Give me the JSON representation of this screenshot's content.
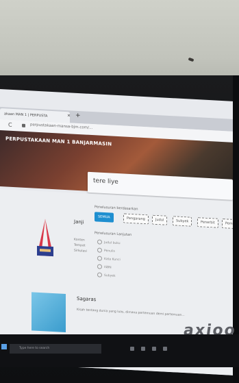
{
  "browser": {
    "tab_title": "akaan MAN 1 | PERPUSTA",
    "tab_close": "×",
    "new_tab": "+",
    "reload": "C",
    "url": "perpustakaan-mansa-bjm.com/..."
  },
  "site": {
    "banner_title": "PERPUSTAKAAN MAN 1 BANJARMASIN"
  },
  "search": {
    "query": "tere liye"
  },
  "filters": {
    "label": "Penelusuran berdasarkan",
    "buttons": [
      "SEMUA",
      "Pengarang",
      "Judul",
      "Subyek",
      "Penerbit",
      "Pem"
    ]
  },
  "fields": {
    "label": "Penelusuran Lanjutan",
    "options": [
      "Judul buku",
      "Penulis",
      "Kata Kunci",
      "ISBN",
      "Subyek"
    ]
  },
  "results": [
    {
      "title": "Janji",
      "meta": [
        "Konten",
        "Tempat",
        "Sirkulasi"
      ]
    },
    {
      "title": "Sagaras",
      "desc": "Kisah tentang dunia yang luas, dimana pertemuan demi pertemuan..."
    }
  ],
  "taskbar": {
    "search_placeholder": "Type here to search"
  },
  "monitor": {
    "brand": "axioo"
  },
  "colors": {
    "accent": "#1f8fd0",
    "wall": "#c9cbc3",
    "bezel": "#141517"
  }
}
